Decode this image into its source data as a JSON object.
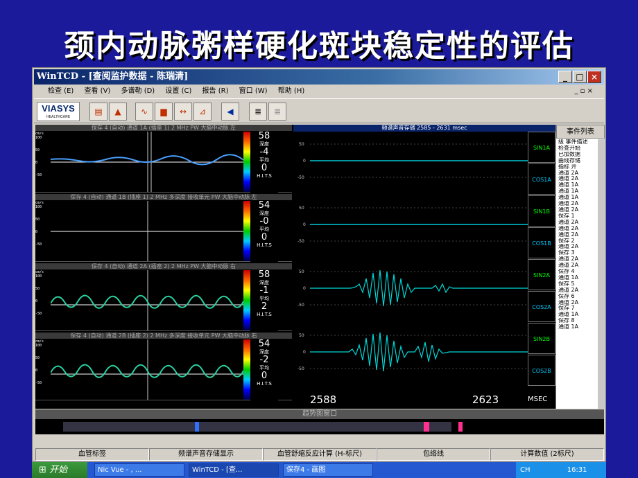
{
  "slide": {
    "title": "颈内动脉粥样硬化斑块稳定性的评估"
  },
  "window": {
    "title": "WinTCD - [查阅监护数据 - 陈瑞清]",
    "buttons": {
      "minimize": "_",
      "maximize": "□",
      "close": "×"
    },
    "mdi": "_ ▫ ×"
  },
  "menu": [
    "检查 (E)",
    "查看 (V)",
    "多谱勒 (D)",
    "设置 (C)",
    "报告 (R)",
    "窗口 (W)",
    "帮助 (H)"
  ],
  "logo": {
    "name": "VIASYS",
    "sub": "HEALTHCARE"
  },
  "panes": [
    {
      "header": "保存 4 (自动) 通道 1A (插座 1) 2 MHz PW 大脑中动脉 左",
      "depth": "58",
      "depth_label": "深度",
      "mean": "-4",
      "mean_label": "平均",
      "hits": "0",
      "hits_label": "H.I.T.S"
    },
    {
      "header": "保存 4 (自动) 通道 1B (插座 1) 2 MHz 多深度 接收单元 PW 大脑中动脉 左",
      "depth": "54",
      "depth_label": "深度",
      "mean": "-0",
      "mean_label": "平均",
      "hits": "0",
      "hits_label": "H.I.T.S"
    },
    {
      "header": "保存 4 (自动) 通道 2A (插座 2) 2 MHz PW 大脑中动脉 右",
      "depth": "58",
      "depth_label": "深度",
      "mean": "-1",
      "mean_label": "平均",
      "hits": "2",
      "hits_label": "H.I.T.S"
    },
    {
      "header": "保存 4 (自动) 通道 2B (插座 2) 2 MHz 多深度 接收单元 PW 大脑中动脉 右",
      "depth": "54",
      "depth_label": "深度",
      "mean": "-2",
      "mean_label": "平均",
      "hits": "0",
      "hits_label": "H.I.T.S"
    }
  ],
  "axis_labels": [
    "cm/s",
    "100",
    "50",
    "0",
    "-50"
  ],
  "spectrum": {
    "header": "频谱声音存储 2585 - 2631 msec",
    "channels": [
      "SIN1A",
      "COS1A",
      "SIN1B",
      "COS1B",
      "SIN2A",
      "COS2A",
      "SIN2B",
      "COS2B"
    ],
    "y_ticks": [
      "50",
      "0",
      "-50"
    ],
    "start": "2588",
    "end": "2623",
    "unit": "MSEC"
  },
  "events": {
    "header": "事件列表",
    "items": [
      "级 事件描述",
      "检查开始",
      "已加数据",
      "曲线存储",
      "指标 开",
      "通道 2A",
      "通道 2A",
      "通道 1A",
      "通道 1A",
      "通道 1A",
      "通道 2A",
      "通道 2A",
      "保存 1",
      "通道 2A",
      "通道 2A",
      "通道 2A",
      "保存 2",
      "通道 2A",
      "保存 3",
      "通道 2A",
      "通道 2A",
      "保存 4",
      "通道 1A",
      "保存 5",
      "通道 2A",
      "保存 6",
      "通道 2A",
      "保存 7",
      "通道 1A",
      "保存 8",
      "通道 1A"
    ]
  },
  "trend": {
    "header": "趋势图窗口"
  },
  "status": [
    "血管标签",
    "频谱声音存储显示",
    "血管舒缩反应计算 (H-标尺)",
    "包络线",
    "计算数值 (2标尺)"
  ],
  "taskbar": {
    "start": "开始",
    "tasks": [
      "Nic Vue - , ...",
      "WinTCD - [查...",
      "保存4 - 画图"
    ],
    "lang": "CH",
    "time": "16:31"
  }
}
